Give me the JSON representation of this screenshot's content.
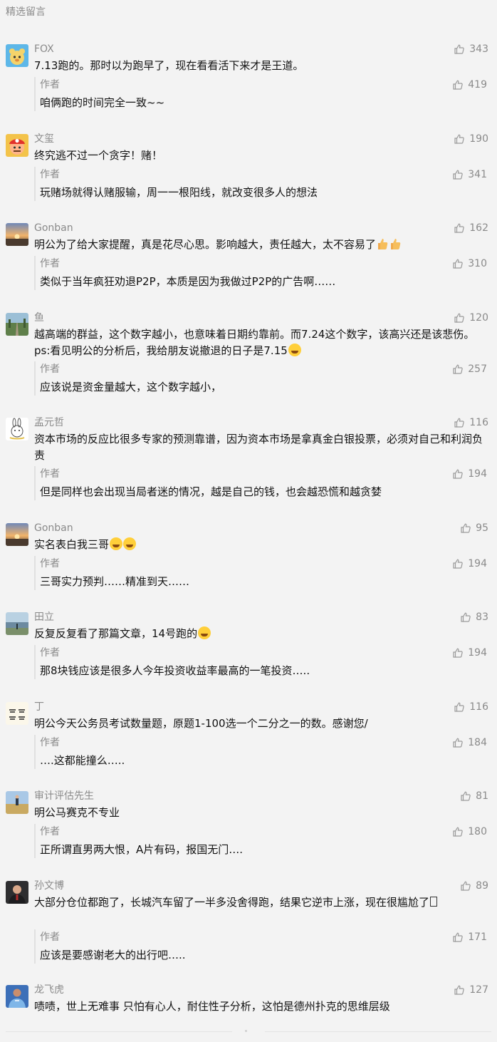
{
  "section_title": "精选留言",
  "reply_author_label": "作者",
  "colors": {
    "muted_text": "#8a8a8a",
    "body_text": "#111111",
    "background": "#f3f3f3",
    "reply_rule": "#e0e0e0"
  },
  "comments": [
    {
      "name": "FOX",
      "likes": "343",
      "text": "7.13跑的。那时以为跑早了，现在看看活下来才是王道。",
      "reply": "咱俩跑的时间完全一致~~",
      "reply_likes": "419",
      "avatar": "cartoon-bear-avatar"
    },
    {
      "name": "文玺",
      "likes": "190",
      "text": "终究逃不过一个贪字！赌！",
      "reply": "玩赌场就得认赌服输，周一一根阳线，就改变很多人的想法",
      "reply_likes": "341",
      "avatar": "cartoon-mario-avatar"
    },
    {
      "name": "Gonban",
      "likes": "162",
      "text": "明公为了给大家提醒，真是花尽心思。影响越大，责任越大，太不容易了",
      "reply": "类似于当年疯狂劝退P2P，本质是因为我做过P2P的广告啊……",
      "reply_likes": "310",
      "avatar": "sunset-avatar"
    },
    {
      "name": "鱼",
      "likes": "120",
      "text": "越高端的群益，这个数字越小，也意味着日期约靠前。而7.24这个数字，该高兴还是该悲伤。ps:看见明公的分析后，我给朋友说撤退的日子是7.15",
      "reply": "应该说是资金量越大，这个数字越小，",
      "reply_likes": "257",
      "avatar": "road-photo-avatar"
    },
    {
      "name": "孟元哲",
      "likes": "116",
      "text": "资本市场的反应比很多专家的预测靠谱，因为资本市场是拿真金白银投票，必须对自己和利润负责",
      "reply": "但是同样也会出现当局者迷的情况，越是自己的钱，也会越恐慌和越贪婪",
      "reply_likes": "194",
      "avatar": "rabbit-sketch-avatar"
    },
    {
      "name": "Gonban",
      "likes": "95",
      "text": "实名表白我三哥",
      "reply": "三哥实力预判……精准到天……",
      "reply_likes": "194",
      "avatar": "sunset-avatar"
    },
    {
      "name": "田立",
      "likes": "83",
      "text": "反复反复看了那篇文章，14号跑的",
      "reply": "那8块钱应该是很多人今年投资收益率最高的一笔投资…..",
      "reply_likes": "194",
      "avatar": "lake-photo-avatar"
    },
    {
      "name": "丁",
      "likes": "116",
      "text": "明公今天公务员考试数量题，原题1-100选一个二分之一的数。感谢您/",
      "reply": "….这都能撞么…..",
      "reply_likes": "184",
      "avatar": "calligraphy-avatar"
    },
    {
      "name": "审计评估先生",
      "likes": "81",
      "text": "明公马赛克不专业",
      "reply": "正所谓直男两大恨，A片有码，报国无门….",
      "reply_likes": "180",
      "avatar": "field-photo-avatar"
    },
    {
      "name": "孙文博",
      "likes": "89",
      "text": "大部分仓位都跑了，长城汽车留了一半多没舍得跑，结果它逆市上涨，现在很尴尬了",
      "reply": "应该是要感谢老大的出行吧…..",
      "reply_likes": "171",
      "avatar": "portrait-photo-avatar"
    },
    {
      "name": "龙飞虎",
      "likes": "127",
      "text": "啧啧，世上无难事 只怕有心人，耐住性子分析，这怕是德州扑克的思维层级",
      "reply": "",
      "reply_likes": "",
      "avatar": "soccer-player-avatar"
    }
  ]
}
